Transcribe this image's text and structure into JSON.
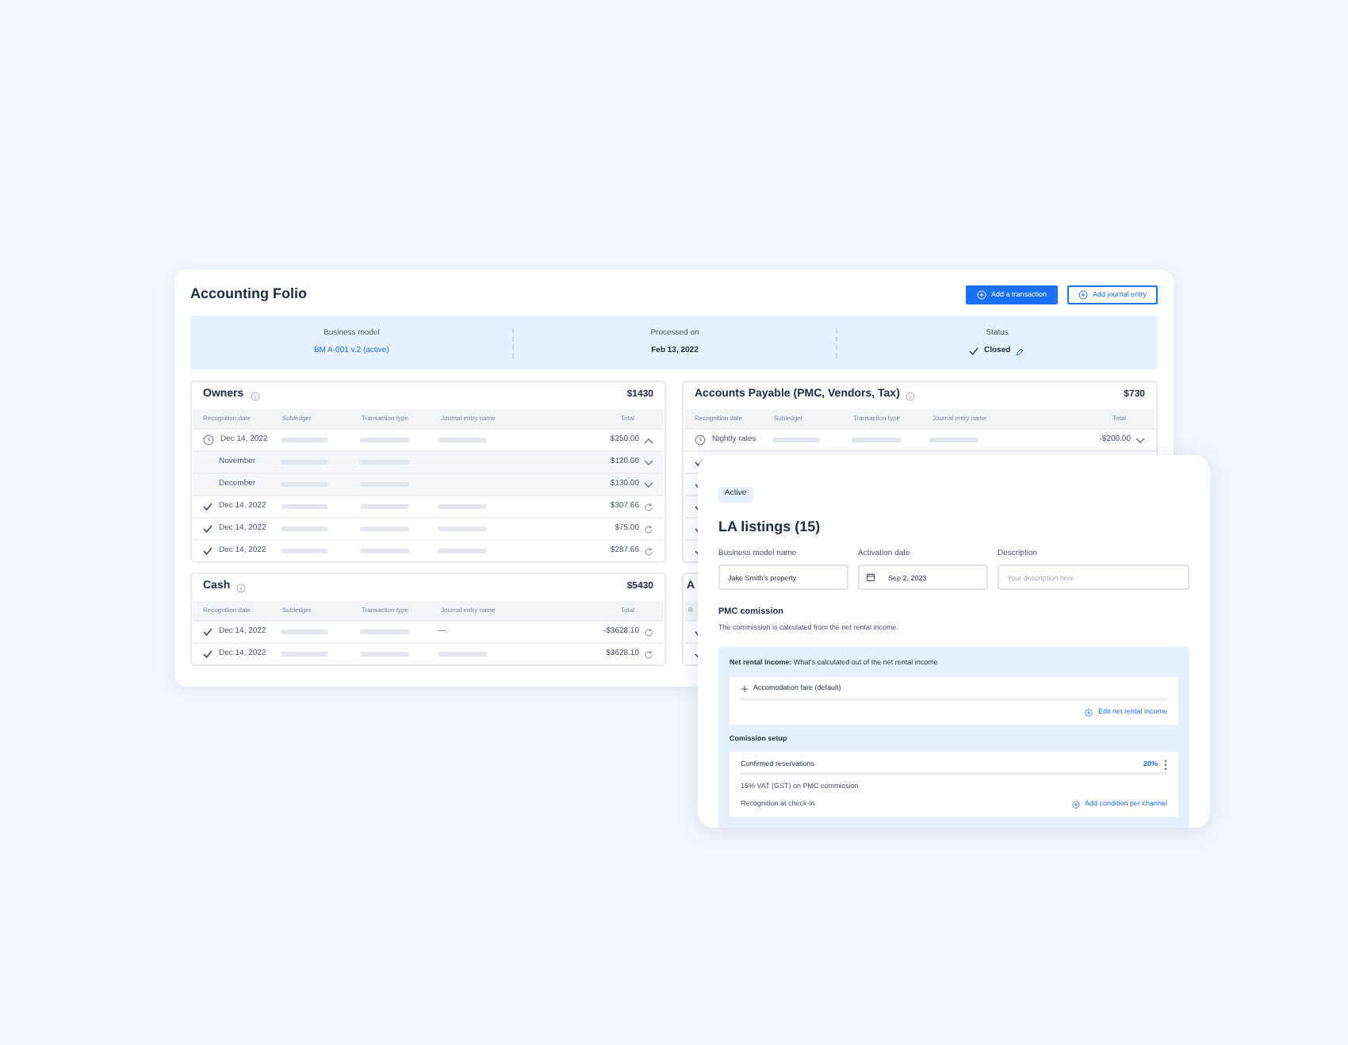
{
  "title": "Accounting Folio",
  "actions": [
    {
      "label": "Add a transaction",
      "kind": "primary"
    },
    {
      "label": "Add journal entry",
      "kind": "secondary"
    }
  ],
  "summary": [
    {
      "label": "Business model",
      "value": "BM A-001 v.2 (active)",
      "kind": "link"
    },
    {
      "label": "Processed on",
      "value": "Feb 13, 2022",
      "kind": "bold"
    },
    {
      "label": "Status",
      "value": "Closed",
      "kind": "status"
    }
  ],
  "tables": [
    {
      "title": "Owners",
      "total": "$1430",
      "columns": [
        "Recognition date",
        "Subledger",
        "Transaction type",
        "Journal entry name",
        "Total"
      ],
      "rows": [
        {
          "kind": "group",
          "date": "Dec 14, 2022",
          "total": "$250.00",
          "expanded": true
        },
        {
          "kind": "sub",
          "date": "November",
          "total": "$120.00",
          "expanded": false
        },
        {
          "kind": "sub",
          "date": "December",
          "total": "$130.00",
          "expanded": false
        },
        {
          "kind": "entry",
          "date": "Dec 14, 2022",
          "total": "$307.66"
        },
        {
          "kind": "entry",
          "date": "Dec 14, 2022",
          "total": "$75.00"
        },
        {
          "kind": "entry",
          "date": "Dec 14, 2022",
          "total": "$287.66"
        }
      ]
    },
    {
      "title": "Accounts Payable (PMC, Vendors, Tax)",
      "total": "$730",
      "columns": [
        "Recognition date",
        "Subledger",
        "Transaction type",
        "Journal entry name",
        "Total"
      ],
      "rows": [
        {
          "kind": "group",
          "date": "Nightly rates",
          "total": "-$200.00",
          "expanded": false
        },
        {
          "kind": "covered"
        },
        {
          "kind": "covered"
        },
        {
          "kind": "covered"
        },
        {
          "kind": "covered"
        },
        {
          "kind": "covered"
        }
      ]
    },
    {
      "title": "Cash",
      "total": "$5430",
      "columns": [
        "Recognition date",
        "Subledger",
        "Transaction type",
        "Journal entry name",
        "Total"
      ],
      "rows": [
        {
          "kind": "entry",
          "date": "Dec 14, 2022",
          "journal": "—",
          "total": "-$3628.10"
        },
        {
          "kind": "entry",
          "date": "Dec 14, 2022",
          "total": "$3628.10"
        }
      ]
    },
    {
      "title": "A",
      "kind": "covered",
      "columns": [
        "R"
      ],
      "rows": [
        {
          "kind": "covered"
        },
        {
          "kind": "covered"
        }
      ]
    }
  ],
  "listing": {
    "badge": "Active",
    "title": "LA listings (15)",
    "fields": [
      {
        "label": "Business model name",
        "value": "Jake Smith's property",
        "kind": "text"
      },
      {
        "label": "Activation date",
        "value": "Sep 2, 2023",
        "kind": "date"
      },
      {
        "label": "Description",
        "placeholder": "Your description here",
        "kind": "text"
      }
    ],
    "commission_title": "PMC comission",
    "commission_description": "The commission is calculated from the net rental income.",
    "net_income": {
      "text": "**Net rental income:** What's calculated out of the net rental income",
      "item": "Accomodation fare (default)",
      "action": "Edit net rental income"
    },
    "setup": {
      "title": "Comission setup",
      "rule": "Confirmed reservations",
      "rate": "20%",
      "tax": "15% VAT (GST) on PMC commission",
      "recognition": "Recognition at check-in",
      "action": "Add condition per channel"
    }
  }
}
